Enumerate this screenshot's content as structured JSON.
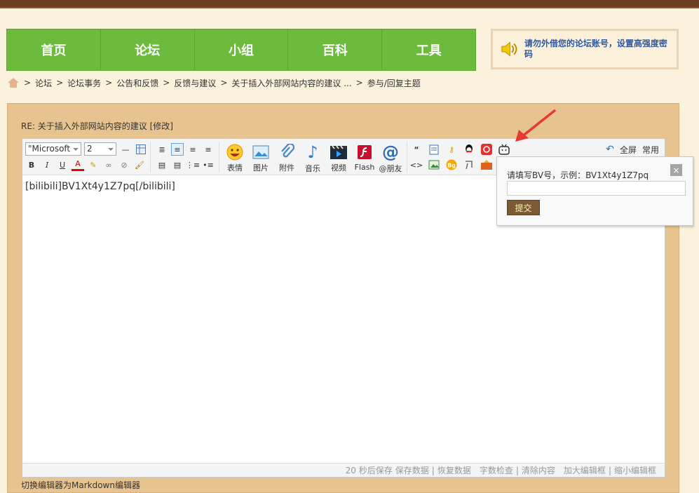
{
  "nav": {
    "items": [
      {
        "label": "首页"
      },
      {
        "label": "论坛"
      },
      {
        "label": "小组"
      },
      {
        "label": "百科"
      },
      {
        "label": "工具"
      }
    ]
  },
  "notice": {
    "text": "请勿外借您的论坛账号，设置高强度密码",
    "icon": "speaker-icon"
  },
  "breadcrumb": {
    "items": [
      "论坛",
      "论坛事务",
      "公告和反馈",
      "反馈与建议",
      "关于插入外部网站内容的建议 ...",
      "参与/回复主题"
    ],
    "separator": ">"
  },
  "post": {
    "title": "RE: 关于插入外部网站内容的建议 [修改]"
  },
  "toolbar": {
    "font_value": "\"Microsoft",
    "size_value": "2",
    "big_buttons": [
      {
        "label": "表情",
        "icon": "smiley-icon"
      },
      {
        "label": "图片",
        "icon": "image-icon"
      },
      {
        "label": "附件",
        "icon": "paperclip-icon"
      },
      {
        "label": "音乐",
        "icon": "music-note-icon"
      },
      {
        "label": "视频",
        "icon": "video-icon"
      },
      {
        "label": "Flash",
        "icon": "flash-icon"
      },
      {
        "label": "@朋友",
        "icon": "at-icon"
      }
    ],
    "fullscreen_label": "全屏",
    "common_label": "常用"
  },
  "editor": {
    "content": "[bilibili]BV1Xt4y1Z7pq[/bilibili]"
  },
  "statusbar": {
    "autosave": "20 秒后保存",
    "save": "保存数据",
    "restore": "恢复数据",
    "wordcheck": "字数检查",
    "clear": "清除内容",
    "enlarge": "加大编辑框",
    "shrink": "缩小编辑框"
  },
  "md_switch": "切换编辑器为Markdown编辑器",
  "popup": {
    "label": "请填写BV号，示例：BV1Xt4y1Z7pq",
    "input_value": "",
    "submit_label": "提交",
    "close_label": "×"
  },
  "colors": {
    "nav_green": "#6cbb3c",
    "panel_tan": "#e7c48f",
    "notice_blue": "#2f5aa0",
    "arrow_red": "#e53935"
  }
}
